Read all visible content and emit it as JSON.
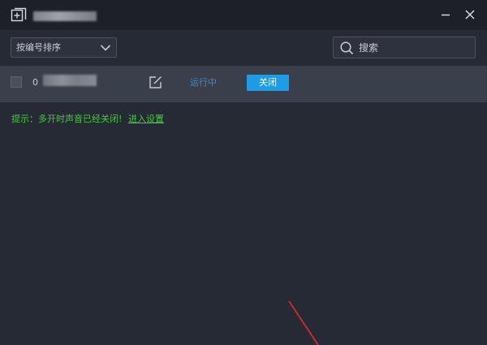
{
  "toolbar": {
    "sort_label": "按编号排序",
    "search_placeholder": "搜索"
  },
  "rows": [
    {
      "index": "0",
      "status": "运行中",
      "close_label": "关闭"
    }
  ],
  "hint": {
    "text": "提示：多开时声音已经关闭!",
    "link": "进入设置"
  },
  "colors": {
    "titlebar_bg": "#1d2029",
    "content_bg": "#262a35",
    "row_bg": "#3a3f4c",
    "accent_blue": "#1e9ce6",
    "status_blue": "#2f8fd8",
    "hint_green": "#46c93f",
    "annotation_red": "#d42a2a"
  },
  "icons": {
    "app": "add-window-icon",
    "minimize": "minimize-icon",
    "close_window": "close-icon",
    "sort_dropdown": "chevron-down-icon",
    "search": "search-icon",
    "edit": "edit-icon",
    "annotation": "red-arrow-annotation"
  }
}
